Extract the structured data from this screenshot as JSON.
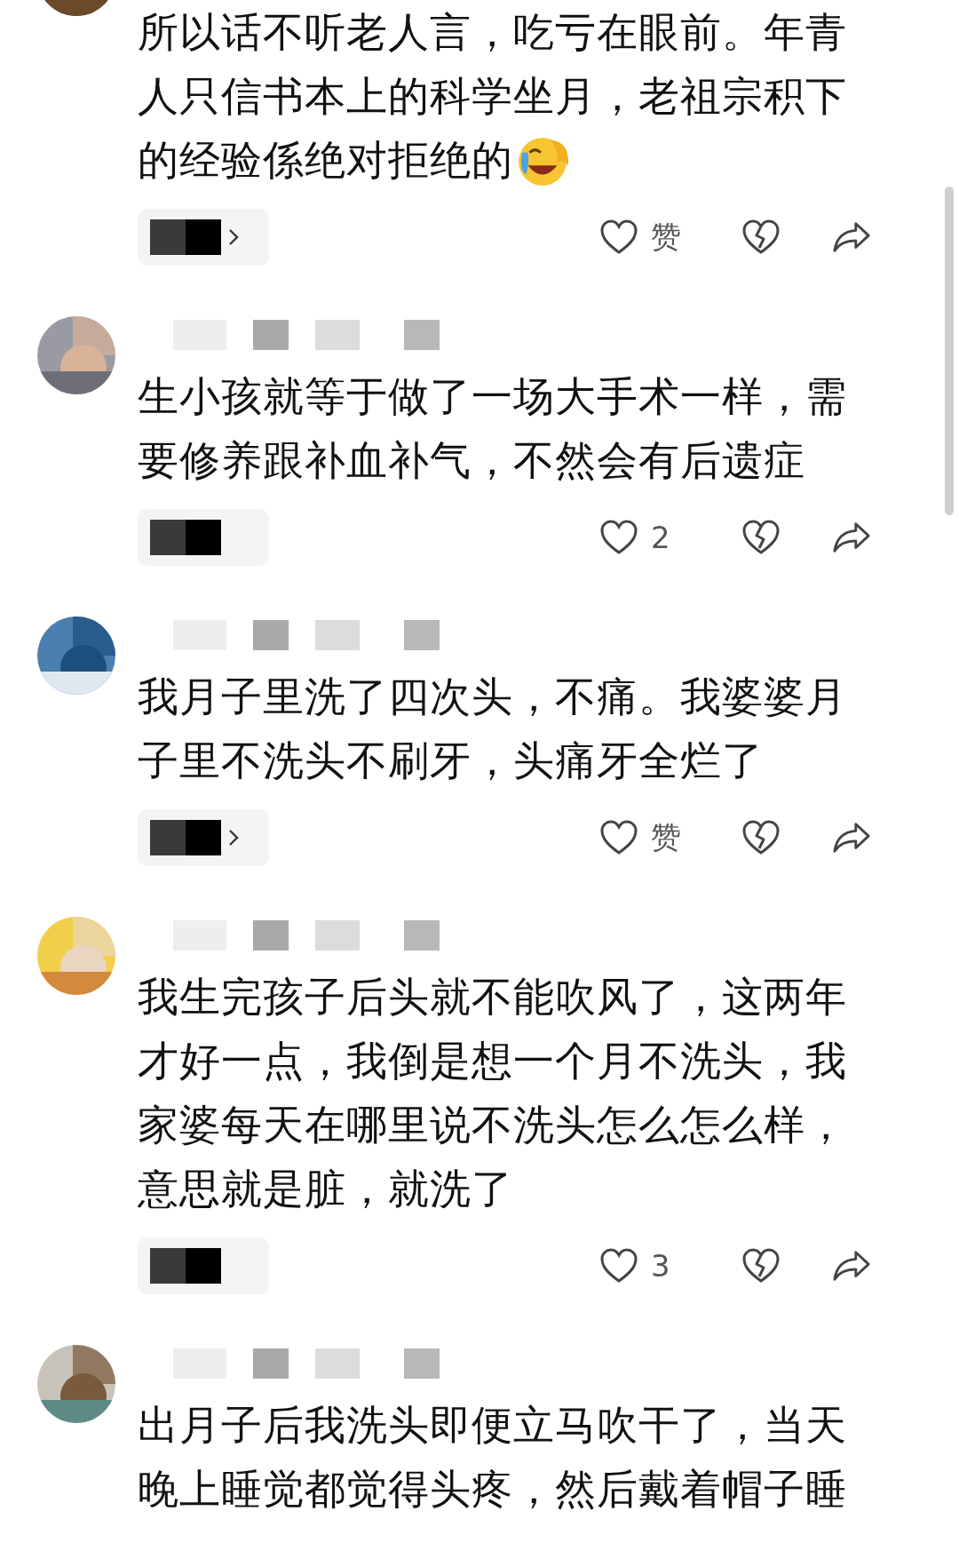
{
  "comments": [
    {
      "header_visible": false,
      "lines": [
        "所以话不听老人言，吃亏在眼前。年青",
        "人只信书本上的科学坐月，老祖宗积下",
        "的经验係绝对拒绝的"
      ],
      "emoji": true,
      "reply_chip": {
        "chevron": true
      },
      "like": {
        "count": "赞"
      }
    },
    {
      "header_visible": true,
      "lines": [
        "生小孩就等于做了一场大手术一样，需",
        "要修养跟补血补气，不然会有后遗症"
      ],
      "reply_chip": {
        "chevron": false
      },
      "like": {
        "count": "2"
      }
    },
    {
      "header_visible": true,
      "lines": [
        "我月子里洗了四次头，不痛。我婆婆月",
        "子里不洗头不刷牙，头痛牙全烂了"
      ],
      "reply_chip": {
        "chevron": true
      },
      "like": {
        "count": "赞"
      }
    },
    {
      "header_visible": true,
      "lines": [
        "我生完孩子后头就不能吹风了，这两年",
        "才好一点，我倒是想一个月不洗头，我",
        "家婆每天在哪里说不洗头怎么怎么样，",
        "意思就是脏，就洗了"
      ],
      "reply_chip": {
        "chevron": false
      },
      "like": {
        "count": "3"
      }
    },
    {
      "header_visible": true,
      "lines": [
        "出月子后我洗头即便立马吹干了，当天",
        "晚上睡觉都觉得头疼，然后戴着帽子睡"
      ]
    }
  ]
}
